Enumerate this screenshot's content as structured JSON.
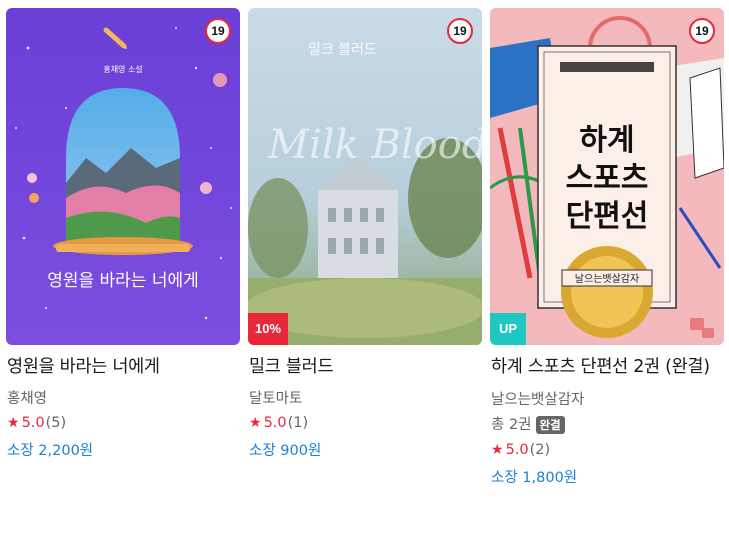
{
  "books": [
    {
      "title": "영원을 바라는 너에게",
      "author": "홍채영",
      "rating": "5.0",
      "rating_count": "(5)",
      "price": "소장 2,200원",
      "age_badge": "19",
      "corner_badge": "",
      "cover_text": "영원을 바라는 너에게",
      "cover_author_line": "홍채영 소설"
    },
    {
      "title": "밀크 블러드",
      "author": "달토마토",
      "rating": "5.0",
      "rating_count": "(1)",
      "price": "소장 900원",
      "age_badge": "19",
      "corner_badge": "10%",
      "cover_text": "밀크 블러드",
      "cover_script": "Milk Blood"
    },
    {
      "title": "하계 스포츠 단편선 2권 (완결)",
      "author": "날으는뱃살감자",
      "volumes": "총 2권",
      "status_tag": "완결",
      "rating": "5.0",
      "rating_count": "(2)",
      "price": "소장 1,800원",
      "age_badge": "19",
      "corner_badge": "UP",
      "cover_title_lines": [
        "하계",
        "스포츠",
        "단편선"
      ],
      "cover_subtitle": "날으는뱃살감자"
    }
  ],
  "icons": {
    "star": "star-icon"
  },
  "colors": {
    "accent_red": "#e8283a",
    "price_blue": "#1e80d4",
    "up_teal": "#1ec8c0"
  }
}
